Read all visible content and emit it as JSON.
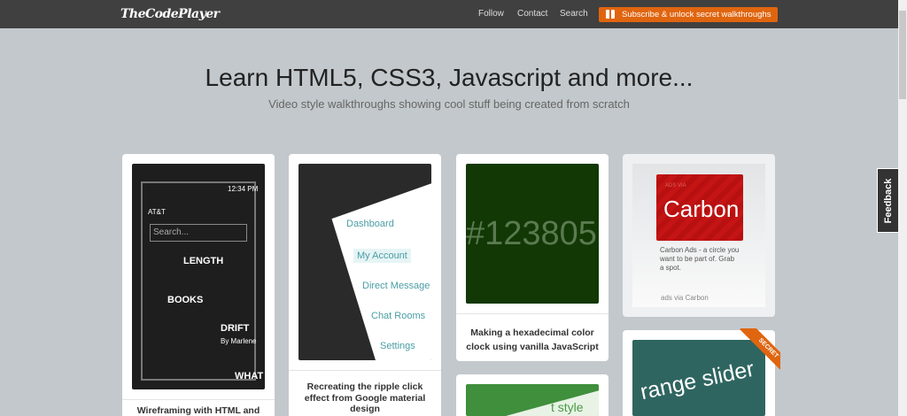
{
  "header": {
    "logo": "TheCodePlayer",
    "nav": [
      "Follow",
      "Contact",
      "Search"
    ],
    "subscribe": "Subscribe & unlock secret walkthroughs"
  },
  "hero": {
    "title": "Learn HTML5, CSS3, Javascript and more...",
    "subtitle": "Video style walkthroughs showing cool stuff being created from scratch"
  },
  "cards": [
    {
      "caption": "Wireframing with HTML and",
      "thumb_texts": [
        "12:34 PM",
        "AT&T",
        "Search...",
        "LENGTH",
        "BOOKS",
        "DRIFT",
        "By Marlene",
        "WHAT"
      ]
    },
    {
      "caption": "Recreating the ripple click effect from Google material design",
      "thumb_texts": [
        "Dashboard",
        "My Account",
        "Direct Message",
        "Chat Rooms",
        "Settings"
      ]
    },
    {
      "caption": "Making a hexadecimal color clock using vanilla JavaScript",
      "thumb_texts": [
        "#123805"
      ]
    },
    {
      "caption": "",
      "thumb_texts": [
        "t style"
      ]
    },
    {
      "caption": "",
      "thumb_texts": [
        "range slider"
      ],
      "badge": "SECRET"
    }
  ],
  "ad": {
    "brand_small": "ADS VIA",
    "brand": "Carbon",
    "text": "Carbon Ads - a circle you want to be part of. Grab a spot.",
    "via": "ads via Carbon"
  },
  "feedback": "Feedback"
}
